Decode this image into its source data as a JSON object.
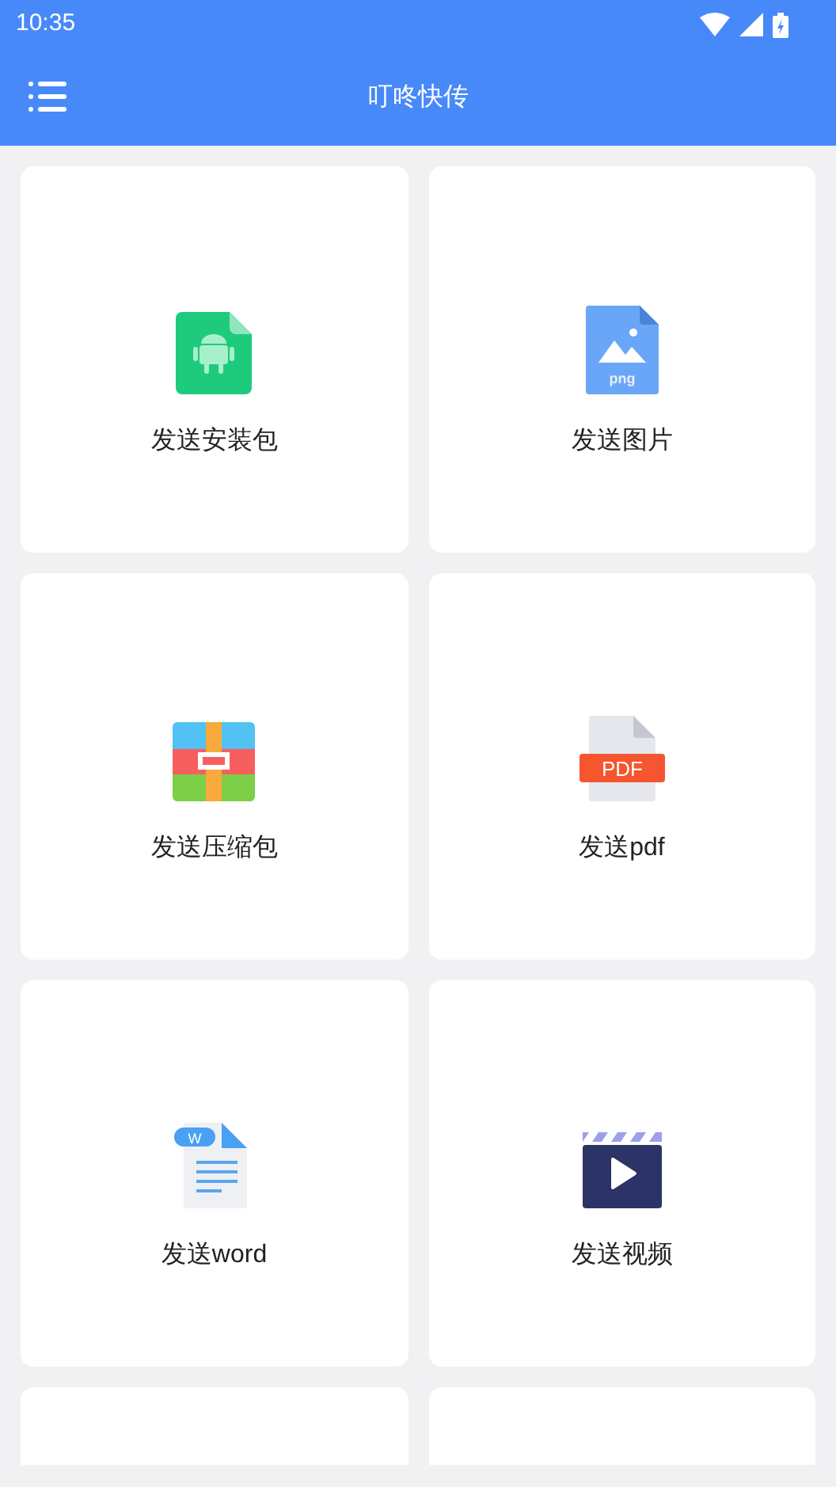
{
  "status_bar": {
    "time": "10:35"
  },
  "app_bar": {
    "title": "叮咚快传"
  },
  "cards": [
    {
      "kind": "apk",
      "label": "发送安装包"
    },
    {
      "kind": "image",
      "label": "发送图片",
      "icon_text": "png"
    },
    {
      "kind": "archive",
      "label": "发送压缩包"
    },
    {
      "kind": "pdf",
      "label": "发送pdf",
      "icon_text": "PDF"
    },
    {
      "kind": "word",
      "label": "发送word",
      "icon_text": "W"
    },
    {
      "kind": "video",
      "label": "发送视频"
    },
    {
      "kind": "empty"
    },
    {
      "kind": "empty"
    }
  ]
}
